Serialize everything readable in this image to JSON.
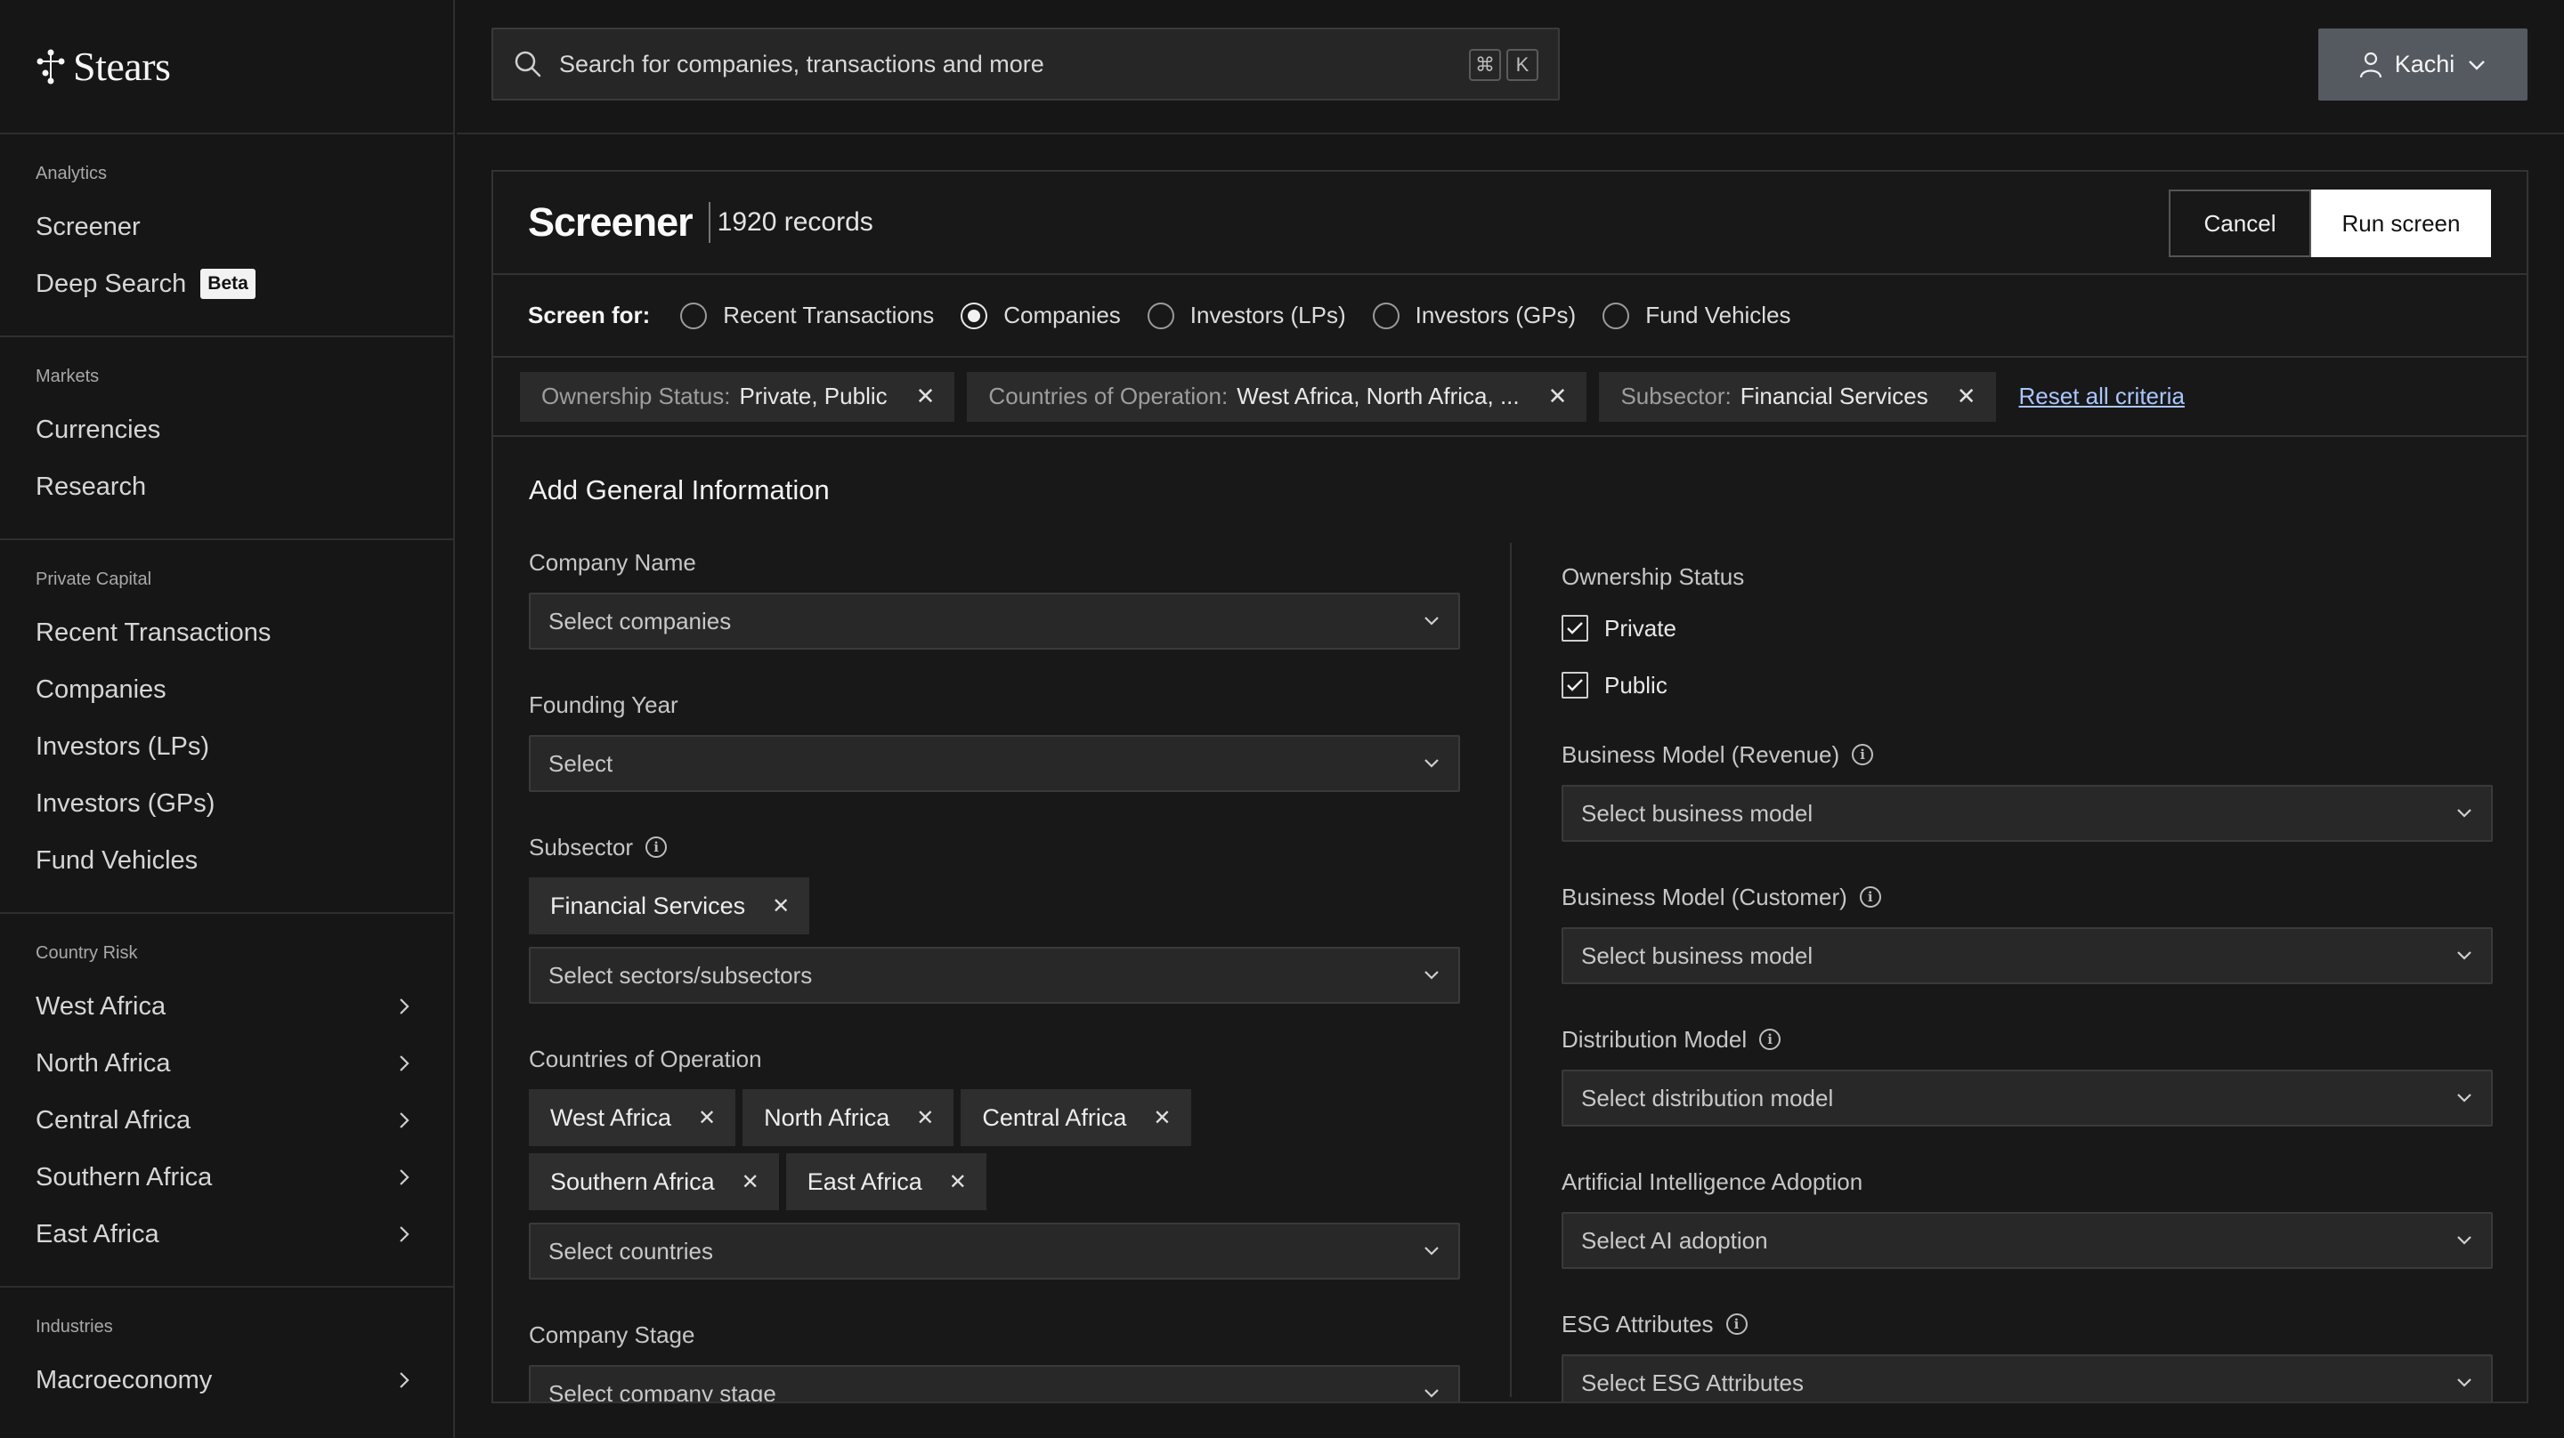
{
  "brand": {
    "name": "Stears"
  },
  "sidebar": {
    "sections": [
      {
        "title": "Analytics",
        "items": [
          {
            "label": "Screener"
          },
          {
            "label": "Deep Search",
            "badge": "Beta"
          }
        ]
      },
      {
        "title": "Markets",
        "items": [
          {
            "label": "Currencies"
          },
          {
            "label": "Research"
          }
        ]
      },
      {
        "title": "Private Capital",
        "items": [
          {
            "label": "Recent Transactions"
          },
          {
            "label": "Companies"
          },
          {
            "label": "Investors (LPs)"
          },
          {
            "label": "Investors (GPs)"
          },
          {
            "label": "Fund Vehicles"
          }
        ]
      },
      {
        "title": "Country Risk",
        "items": [
          {
            "label": "West Africa"
          },
          {
            "label": "North Africa"
          },
          {
            "label": "Central Africa"
          },
          {
            "label": "Southern Africa"
          },
          {
            "label": "East Africa"
          }
        ]
      },
      {
        "title": "Industries",
        "items": [
          {
            "label": "Macroeconomy"
          }
        ]
      }
    ]
  },
  "search": {
    "placeholder": "Search for companies, transactions and more",
    "shortcut_keys": [
      "⌘",
      "K"
    ]
  },
  "user": {
    "name": "Kachi"
  },
  "screener": {
    "title": "Screener",
    "records": "1920 records",
    "cancel_label": "Cancel",
    "run_label": "Run screen",
    "screen_for_label": "Screen for:",
    "screen_for_options": [
      {
        "label": "Recent Transactions",
        "selected": false
      },
      {
        "label": "Companies",
        "selected": true
      },
      {
        "label": "Investors (LPs)",
        "selected": false
      },
      {
        "label": "Investors (GPs)",
        "selected": false
      },
      {
        "label": "Fund Vehicles",
        "selected": false
      }
    ],
    "criteria": [
      {
        "key": "Ownership Status:",
        "value": "Private, Public"
      },
      {
        "key": "Countries of Operation:",
        "value": "West Africa, North Africa, ..."
      },
      {
        "key": "Subsector:",
        "value": "Financial Services"
      }
    ],
    "reset_label": "Reset all criteria",
    "section_title": "Add General Information",
    "left_fields": {
      "company_name": {
        "label": "Company Name",
        "placeholder": "Select companies"
      },
      "founding_year": {
        "label": "Founding Year",
        "placeholder": "Select"
      },
      "subsector": {
        "label": "Subsector",
        "chips": [
          "Financial Services"
        ],
        "placeholder": "Select sectors/subsectors"
      },
      "countries": {
        "label": "Countries of Operation",
        "chips": [
          "West Africa",
          "North Africa",
          "Central Africa",
          "Southern Africa",
          "East Africa"
        ],
        "placeholder": "Select countries"
      },
      "company_stage": {
        "label": "Company Stage",
        "placeholder": "Select company stage"
      }
    },
    "right_fields": {
      "ownership": {
        "label": "Ownership Status",
        "options": [
          {
            "label": "Private",
            "checked": true
          },
          {
            "label": "Public",
            "checked": true
          }
        ]
      },
      "bm_revenue": {
        "label": "Business Model (Revenue)",
        "placeholder": "Select business model"
      },
      "bm_customer": {
        "label": "Business Model (Customer)",
        "placeholder": "Select business model"
      },
      "distribution": {
        "label": "Distribution Model",
        "placeholder": "Select distribution model"
      },
      "ai_adoption": {
        "label": "Artificial Intelligence Adoption",
        "placeholder": "Select AI adoption"
      },
      "esg": {
        "label": "ESG Attributes",
        "placeholder": "Select ESG Attributes"
      }
    }
  }
}
